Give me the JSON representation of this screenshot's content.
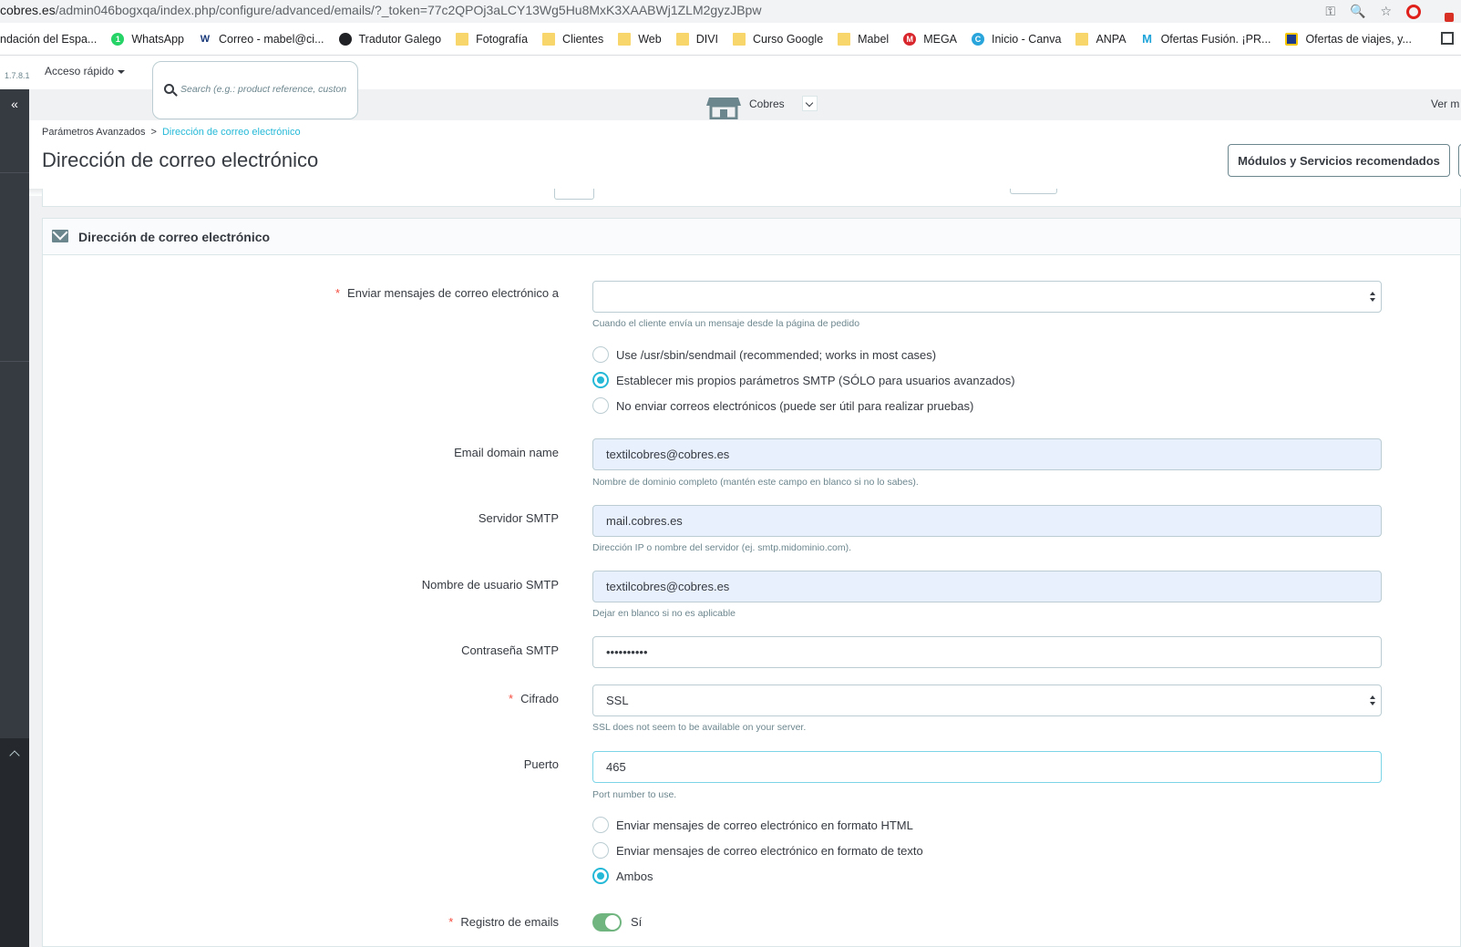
{
  "browser": {
    "url_host": "cobres.es",
    "url_path": "/admin046bogxqa/index.php/configure/advanced/emails/?_token=77c2QPOj3aLCY13Wg5Hu8MxK3XAABWj1ZLM2gyzJBpw",
    "bookmarks": [
      {
        "label": "ndación del Espa...",
        "icon": "none"
      },
      {
        "label": "WhatsApp",
        "icon": "whatsapp-icon"
      },
      {
        "label": "Correo - mabel@ci...",
        "icon": "ms-icon"
      },
      {
        "label": "Tradutor Galego",
        "icon": "globe-icon"
      },
      {
        "label": "Fotografía",
        "icon": "folder-icon"
      },
      {
        "label": "Clientes",
        "icon": "folder-icon"
      },
      {
        "label": "Web",
        "icon": "folder-icon"
      },
      {
        "label": "DIVI",
        "icon": "folder-icon"
      },
      {
        "label": "Curso Google",
        "icon": "folder-icon"
      },
      {
        "label": "Mabel",
        "icon": "folder-icon"
      },
      {
        "label": "MEGA",
        "icon": "mega-icon"
      },
      {
        "label": "Inicio - Canva",
        "icon": "canva-icon"
      },
      {
        "label": "ANPA",
        "icon": "folder-icon"
      },
      {
        "label": "Ofertas Fusión. ¡PR...",
        "icon": "movistar-icon"
      },
      {
        "label": "Ofertas de viajes, y...",
        "icon": "offer-icon"
      }
    ]
  },
  "topbar": {
    "version": "1.7.8.1",
    "quick_access": "Acceso rápido",
    "search_placeholder": "Search (e.g.: product reference, custon",
    "shop_name": "Cobres",
    "view_more": "Ver m"
  },
  "header": {
    "breadcrumb_parent": "Parámetros Avanzados",
    "breadcrumb_sep": ">",
    "breadcrumb_current": "Dirección de correo electrónico",
    "title": "Dirección de correo electrónico",
    "recommended_button": "Módulos y Servicios recomendados"
  },
  "card": {
    "title": "Dirección de correo electrónico"
  },
  "form": {
    "send_to": {
      "label": "Enviar mensajes de correo electrónico a",
      "value": "",
      "help": "Cuando el cliente envía un mensaje desde la página de pedido"
    },
    "mail_method": {
      "options": [
        "Use /usr/sbin/sendmail (recommended; works in most cases)",
        "Establecer mis propios parámetros SMTP (SÓLO para usuarios avanzados)",
        "No enviar correos electrónicos (puede ser útil para realizar pruebas)"
      ],
      "selected": 1
    },
    "domain": {
      "label": "Email domain name",
      "value": "textilcobres@cobres.es",
      "help": "Nombre de dominio completo (mantén este campo en blanco si no lo sabes)."
    },
    "smtp_server": {
      "label": "Servidor SMTP",
      "value": "mail.cobres.es",
      "help": "Dirección IP o nombre del servidor (ej. smtp.midominio.com)."
    },
    "smtp_user": {
      "label": "Nombre de usuario SMTP",
      "value": "textilcobres@cobres.es",
      "help": "Dejar en blanco si no es aplicable"
    },
    "smtp_password": {
      "label": "Contraseña SMTP",
      "value": "••••••••••"
    },
    "encryption": {
      "label": "Cifrado",
      "value": "SSL",
      "help": "SSL does not seem to be available on your server."
    },
    "port": {
      "label": "Puerto",
      "value": "465",
      "help": "Port number to use."
    },
    "mail_format": {
      "options": [
        "Enviar mensajes de correo electrónico en formato HTML",
        "Enviar mensajes de correo electrónico en formato de texto",
        "Ambos"
      ],
      "selected": 2
    },
    "log_emails": {
      "label": "Registro de emails",
      "value": "Sí",
      "enabled": true
    },
    "required_mark": "*"
  },
  "colors": {
    "accent": "#25b9d7",
    "sidebar": "#363a41",
    "toggle_on": "#70b580",
    "required": "#f54c3e"
  }
}
